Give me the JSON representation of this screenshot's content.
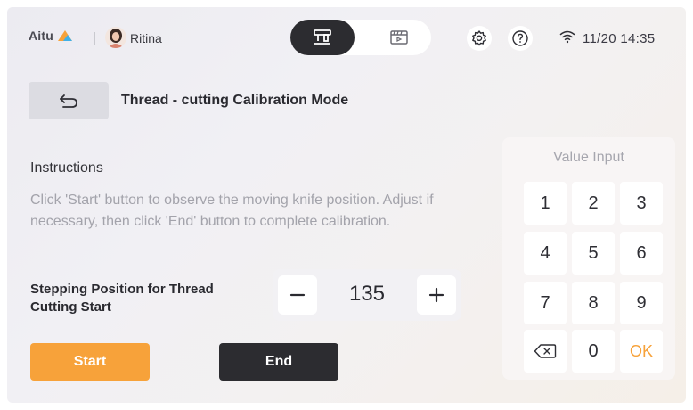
{
  "status_bar": {
    "brand": "Aitu",
    "user_name": "Ritina",
    "clock": "11/20 14:35",
    "icons": {
      "mode_active": "machine-icon",
      "mode_inactive": "video-icon",
      "settings": "gear-icon",
      "help": "help-icon",
      "wifi": "wifi-icon"
    }
  },
  "header": {
    "title": "Thread - cutting Calibration Mode",
    "back_icon": "back-arrow-icon"
  },
  "instructions": {
    "heading": "Instructions",
    "body": "Click 'Start' button to observe the moving knife position. Adjust if necessary, then click 'End' button to complete calibration."
  },
  "stepper": {
    "label": "Stepping Position for Thread Cutting Start",
    "value": "135",
    "minus_label": "−",
    "plus_label": "+"
  },
  "actions": {
    "start_label": "Start",
    "end_label": "End"
  },
  "keypad": {
    "title": "Value Input",
    "keys": [
      "1",
      "2",
      "3",
      "4",
      "5",
      "6",
      "7",
      "8",
      "9",
      "",
      "0",
      "OK"
    ],
    "backspace_icon": "backspace-icon"
  },
  "colors": {
    "accent": "#f7a23a",
    "dark": "#2c2c30",
    "muted_text": "#a3a3ab"
  }
}
